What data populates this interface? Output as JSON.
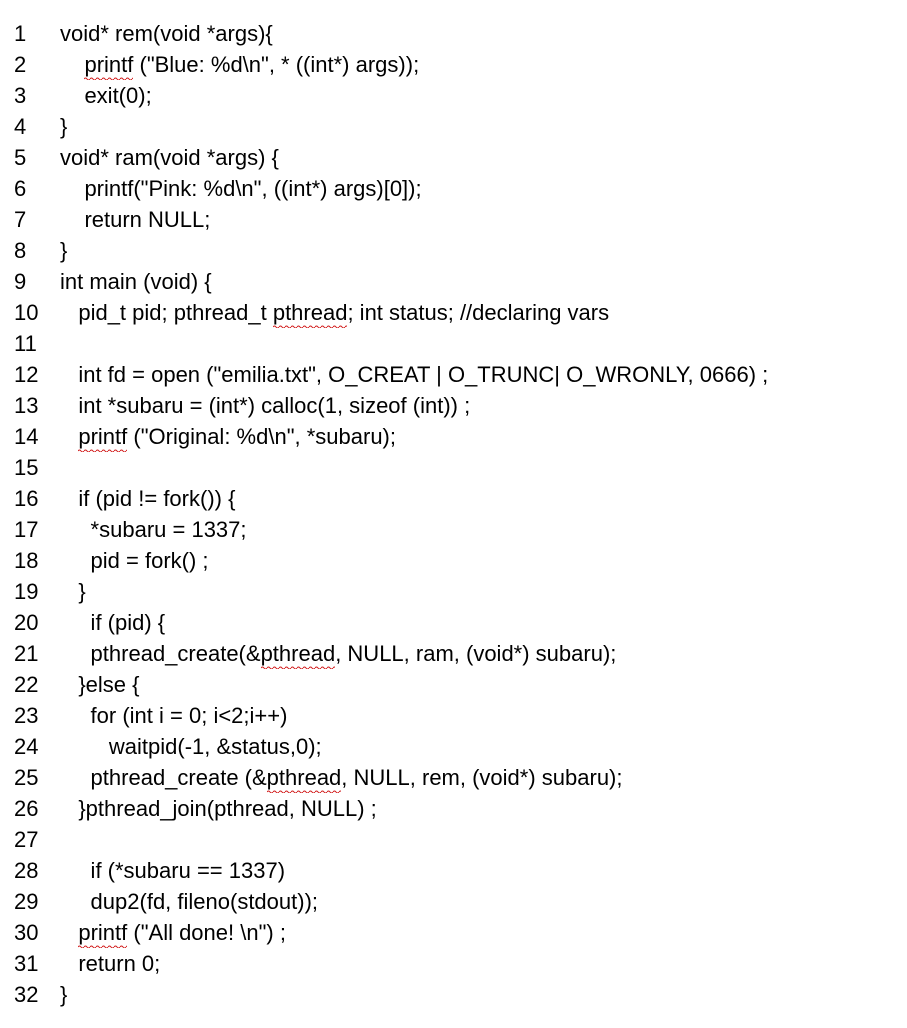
{
  "lines": [
    {
      "no": "1",
      "segs": [
        [
          "void* rem(void *args){",
          false
        ]
      ]
    },
    {
      "no": "2",
      "segs": [
        [
          "    ",
          false
        ],
        [
          "printf",
          true
        ],
        [
          " (\"Blue: %d\\n\", * ((int*) args));",
          false
        ]
      ]
    },
    {
      "no": "3",
      "segs": [
        [
          "    exit(0);",
          false
        ]
      ]
    },
    {
      "no": "4",
      "segs": [
        [
          "}",
          false
        ]
      ]
    },
    {
      "no": "5",
      "segs": [
        [
          "void* ram(void *args) {",
          false
        ]
      ]
    },
    {
      "no": "6",
      "segs": [
        [
          "    printf(\"Pink: %d\\n\", ((int*) args)[0]);",
          false
        ]
      ]
    },
    {
      "no": "7",
      "segs": [
        [
          "    return NULL;",
          false
        ]
      ]
    },
    {
      "no": "8",
      "segs": [
        [
          "}",
          false
        ]
      ]
    },
    {
      "no": "9",
      "segs": [
        [
          "int main (void) {",
          false
        ]
      ]
    },
    {
      "no": "10",
      "segs": [
        [
          "   pid_t pid; pthread_t ",
          false
        ],
        [
          "pthread",
          true
        ],
        [
          "; int status; //declaring vars",
          false
        ]
      ]
    },
    {
      "no": "11",
      "segs": [
        [
          "",
          false
        ]
      ]
    },
    {
      "no": "12",
      "segs": [
        [
          "   int fd = open (\"emilia.txt\", O_CREAT | O_TRUNC| O_WRONLY, 0666) ;",
          false
        ]
      ]
    },
    {
      "no": "13",
      "segs": [
        [
          "   int *subaru = (int*) calloc(1, sizeof (int)) ;",
          false
        ]
      ]
    },
    {
      "no": "14",
      "segs": [
        [
          "   ",
          false
        ],
        [
          "printf",
          true
        ],
        [
          " (\"Original: %d\\n\", *subaru);",
          false
        ]
      ]
    },
    {
      "no": "15",
      "segs": [
        [
          "",
          false
        ]
      ]
    },
    {
      "no": "16",
      "segs": [
        [
          "   if (pid != fork()) {",
          false
        ]
      ]
    },
    {
      "no": "17",
      "segs": [
        [
          "     *subaru = 1337;",
          false
        ]
      ]
    },
    {
      "no": "18",
      "segs": [
        [
          "     pid = fork() ;",
          false
        ]
      ]
    },
    {
      "no": "19",
      "segs": [
        [
          "   }",
          false
        ]
      ]
    },
    {
      "no": "20",
      "segs": [
        [
          "     if (pid) {",
          false
        ]
      ]
    },
    {
      "no": "21",
      "segs": [
        [
          "     pthread_create(&",
          false
        ],
        [
          "pthread",
          true
        ],
        [
          ", NULL, ram, (void*) subaru);",
          false
        ]
      ]
    },
    {
      "no": "22",
      "segs": [
        [
          "   }else {",
          false
        ]
      ]
    },
    {
      "no": "23",
      "segs": [
        [
          "     for (int i = 0; i<2;i++)",
          false
        ]
      ]
    },
    {
      "no": "24",
      "segs": [
        [
          "        waitpid(-1, &status,0);",
          false
        ]
      ]
    },
    {
      "no": "25",
      "segs": [
        [
          "     pthread_create (&",
          false
        ],
        [
          "pthread",
          true
        ],
        [
          ", NULL, rem, (void*) subaru);",
          false
        ]
      ]
    },
    {
      "no": "26",
      "segs": [
        [
          "   }pthread_join(pthread, NULL) ;",
          false
        ]
      ]
    },
    {
      "no": "27",
      "segs": [
        [
          "",
          false
        ]
      ]
    },
    {
      "no": "28",
      "segs": [
        [
          "     if (*subaru == 1337)",
          false
        ]
      ]
    },
    {
      "no": "29",
      "segs": [
        [
          "     dup2(fd, fileno(stdout));",
          false
        ]
      ]
    },
    {
      "no": "30",
      "segs": [
        [
          "   ",
          false
        ],
        [
          "printf",
          true
        ],
        [
          " (\"All done! \\n\") ;",
          false
        ]
      ]
    },
    {
      "no": "31",
      "segs": [
        [
          "   return 0;",
          false
        ]
      ]
    },
    {
      "no": "32",
      "segs": [
        [
          "}",
          false
        ]
      ]
    }
  ]
}
